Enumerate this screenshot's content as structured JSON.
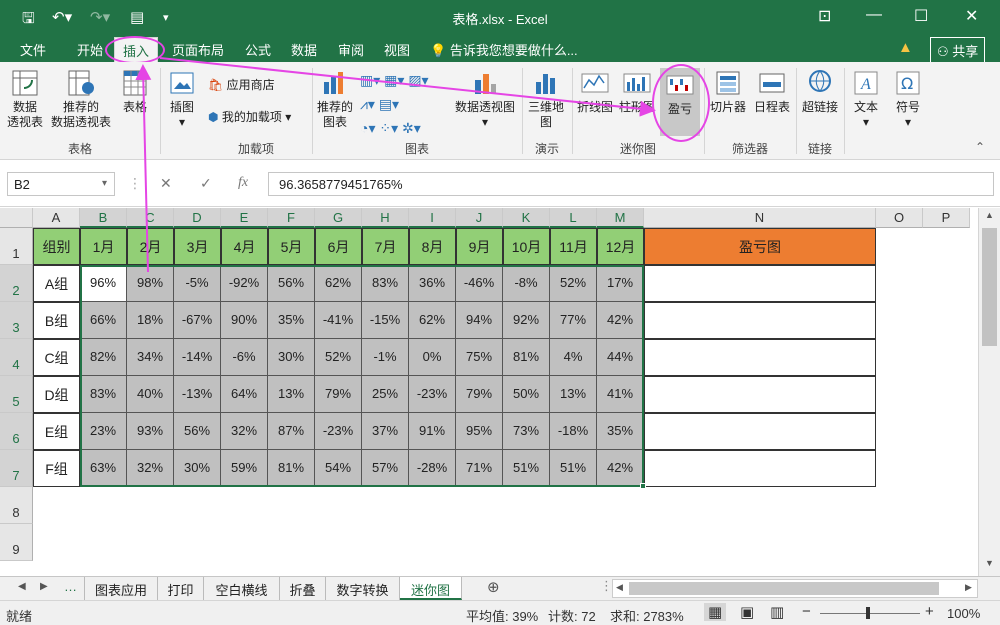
{
  "title": "表格.xlsx - Excel",
  "tabs": [
    "文件",
    "开始",
    "插入",
    "页面布局",
    "公式",
    "数据",
    "审阅",
    "视图"
  ],
  "tell_me": "告诉我您想要做什么...",
  "share": "共享",
  "ribbon": {
    "pivot": "数据\n透视表",
    "rec_pivot": "推荐的\n数据透视表",
    "table": "表格",
    "illus": "插图",
    "store": "应用商店",
    "myaddins": "我的加载项",
    "rec_charts": "推荐的\n图表",
    "pivotchart": "数据透视图",
    "map3d": "三维地\n图",
    "spark_line": "折线图",
    "spark_col": "柱形图",
    "spark_wl": "盈亏",
    "slicer": "切片器",
    "timeline": "日程表",
    "hyperlink": "超链接",
    "text": "文本",
    "symbol": "符号",
    "groups": [
      "表格",
      "加载项",
      "图表",
      "演示",
      "迷你图",
      "筛选器",
      "链接"
    ]
  },
  "namebox": "B2",
  "formula": "96.3658779451765%",
  "columns": [
    "A",
    "B",
    "C",
    "D",
    "E",
    "F",
    "G",
    "H",
    "I",
    "J",
    "K",
    "L",
    "M",
    "N",
    "O",
    "P"
  ],
  "rows": [
    "1",
    "2",
    "3",
    "4",
    "5",
    "6",
    "7",
    "8",
    "9"
  ],
  "table": {
    "header": [
      "组别",
      "1月",
      "2月",
      "3月",
      "4月",
      "5月",
      "6月",
      "7月",
      "8月",
      "9月",
      "10月",
      "11月",
      "12月"
    ],
    "sparkline_header": "盈亏图",
    "rows": [
      [
        "A组",
        "96%",
        "98%",
        "-5%",
        "-92%",
        "56%",
        "62%",
        "83%",
        "36%",
        "-46%",
        "-8%",
        "52%",
        "17%"
      ],
      [
        "B组",
        "66%",
        "18%",
        "-67%",
        "90%",
        "35%",
        "-41%",
        "-15%",
        "62%",
        "94%",
        "92%",
        "77%",
        "42%"
      ],
      [
        "C组",
        "82%",
        "34%",
        "-14%",
        "-6%",
        "30%",
        "52%",
        "-1%",
        "0%",
        "75%",
        "81%",
        "4%",
        "44%"
      ],
      [
        "D组",
        "83%",
        "40%",
        "-13%",
        "64%",
        "13%",
        "79%",
        "25%",
        "-23%",
        "79%",
        "50%",
        "13%",
        "41%"
      ],
      [
        "E组",
        "23%",
        "93%",
        "56%",
        "32%",
        "87%",
        "-23%",
        "37%",
        "91%",
        "95%",
        "73%",
        "-18%",
        "35%"
      ],
      [
        "F组",
        "63%",
        "32%",
        "30%",
        "59%",
        "81%",
        "54%",
        "57%",
        "-28%",
        "71%",
        "51%",
        "51%",
        "42%"
      ]
    ]
  },
  "sheets": [
    "图表应用",
    "打印",
    "空白横线",
    "折叠",
    "数字转换",
    "迷你图"
  ],
  "status": {
    "ready": "就绪",
    "avg": "平均值: 39%",
    "count": "计数: 72",
    "sum": "求和: 2783%",
    "zoom": "100%"
  }
}
